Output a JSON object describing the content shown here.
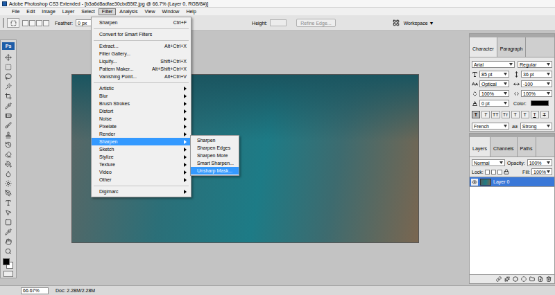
{
  "window": {
    "title": "Adobe Photoshop CS3 Extended - [b3a6d8adfae30cbd55f2.jpg @ 66.7% (Layer 0, RGB/8#)]"
  },
  "menu_bar": [
    {
      "label": "File",
      "selected": false
    },
    {
      "label": "Edit",
      "selected": false
    },
    {
      "label": "Image",
      "selected": false
    },
    {
      "label": "Layer",
      "selected": false
    },
    {
      "label": "Select",
      "selected": false
    },
    {
      "label": "Filter",
      "selected": true
    },
    {
      "label": "Analysis",
      "selected": false
    },
    {
      "label": "View",
      "selected": false
    },
    {
      "label": "Window",
      "selected": false
    },
    {
      "label": "Help",
      "selected": false
    }
  ],
  "options_bar": {
    "feather_label": "Feather:",
    "feather_value": "0 px",
    "height_label": "Height:",
    "refine_edge": "Refine Edge...",
    "workspace": "Workspace ▼"
  },
  "toolbox": {
    "logo": "Ps"
  },
  "filter_menu": [
    {
      "kind": "item",
      "label": "Sharpen",
      "shortcut": "Ctrl+F",
      "selected": false
    },
    {
      "kind": "separator"
    },
    {
      "kind": "item",
      "label": "Convert for Smart Filters",
      "shortcut": "",
      "selected": false
    },
    {
      "kind": "separator"
    },
    {
      "kind": "item",
      "label": "Extract...",
      "shortcut": "Alt+Ctrl+X",
      "selected": false
    },
    {
      "kind": "item",
      "label": "Filter Gallery...",
      "shortcut": "",
      "selected": false
    },
    {
      "kind": "item",
      "label": "Liquify...",
      "shortcut": "Shift+Ctrl+X",
      "selected": false
    },
    {
      "kind": "item",
      "label": "Pattern Maker...",
      "shortcut": "Alt+Shift+Ctrl+X",
      "selected": false
    },
    {
      "kind": "item",
      "label": "Vanishing Point...",
      "shortcut": "Alt+Ctrl+V",
      "selected": false
    },
    {
      "kind": "separator"
    },
    {
      "kind": "submenu",
      "label": "Artistic",
      "selected": false
    },
    {
      "kind": "submenu",
      "label": "Blur",
      "selected": false
    },
    {
      "kind": "submenu",
      "label": "Brush Strokes",
      "selected": false
    },
    {
      "kind": "submenu",
      "label": "Distort",
      "selected": false
    },
    {
      "kind": "submenu",
      "label": "Noise",
      "selected": false
    },
    {
      "kind": "submenu",
      "label": "Pixelate",
      "selected": false
    },
    {
      "kind": "submenu",
      "label": "Render",
      "selected": false
    },
    {
      "kind": "submenu",
      "label": "Sharpen",
      "selected": true
    },
    {
      "kind": "submenu",
      "label": "Sketch",
      "selected": false
    },
    {
      "kind": "submenu",
      "label": "Stylize",
      "selected": false
    },
    {
      "kind": "submenu",
      "label": "Texture",
      "selected": false
    },
    {
      "kind": "submenu",
      "label": "Video",
      "selected": false
    },
    {
      "kind": "submenu",
      "label": "Other",
      "selected": false
    },
    {
      "kind": "separator"
    },
    {
      "kind": "submenu",
      "label": "Digimarc",
      "selected": false
    }
  ],
  "sharpen_submenu": [
    {
      "label": "Sharpen",
      "selected": false
    },
    {
      "label": "Sharpen Edges",
      "selected": false
    },
    {
      "label": "Sharpen More",
      "selected": false
    },
    {
      "label": "Smart Sharpen...",
      "selected": false
    },
    {
      "label": "Unsharp Mask...",
      "selected": true
    }
  ],
  "character_panel": {
    "tabs": [
      {
        "label": "Character",
        "selected": true
      },
      {
        "label": "Paragraph",
        "selected": false
      }
    ],
    "font_family": "Arial",
    "font_style": "Regular",
    "font_size": "85 pt",
    "leading": "36 pt",
    "kerning": "Optical",
    "tracking": "-100",
    "vertical_scale": "100%",
    "horizontal_scale": "100%",
    "baseline_shift": "0 pt",
    "color_label": "Color:",
    "style_buttons": [
      {
        "label": "T",
        "kind": "bold",
        "selected": true
      },
      {
        "label": "T",
        "kind": "italic",
        "selected": false
      },
      {
        "label": "TT",
        "kind": "caps",
        "selected": false
      },
      {
        "label": "Tт",
        "kind": "smallcaps",
        "selected": false
      },
      {
        "label": "T",
        "kind": "super",
        "selected": false
      },
      {
        "label": "T",
        "kind": "sub",
        "selected": false
      },
      {
        "label": "T",
        "kind": "underline",
        "selected": false
      },
      {
        "label": "T",
        "kind": "strike",
        "selected": false
      }
    ],
    "language": "French",
    "aa_label": "aa",
    "antialias": "Strong"
  },
  "layers_panel": {
    "tabs": [
      {
        "label": "Layers",
        "selected": true
      },
      {
        "label": "Channels",
        "selected": false
      },
      {
        "label": "Paths",
        "selected": false
      }
    ],
    "blend_mode": "Normal",
    "opacity_label": "Opacity:",
    "opacity": "100%",
    "lock_label": "Lock:",
    "fill_label": "Fill:",
    "fill": "100%",
    "layers": [
      {
        "name": "Layer 0",
        "selected": true,
        "visible": true
      }
    ]
  },
  "status_bar": {
    "zoom": "66.67%",
    "doc": "Doc: 2.28M/2.28M"
  }
}
